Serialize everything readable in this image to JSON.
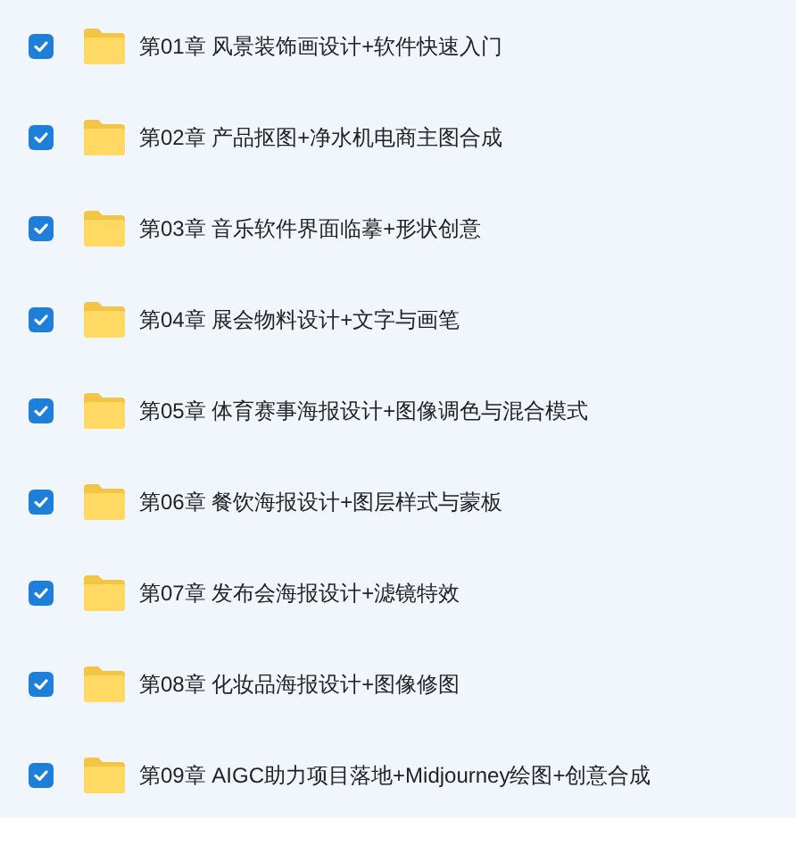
{
  "files": [
    {
      "name": "第01章 风景装饰画设计+软件快速入门",
      "checked": true
    },
    {
      "name": "第02章 产品抠图+净水机电商主图合成",
      "checked": true
    },
    {
      "name": "第03章 音乐软件界面临摹+形状创意",
      "checked": true
    },
    {
      "name": "第04章 展会物料设计+文字与画笔",
      "checked": true
    },
    {
      "name": "第05章 体育赛事海报设计+图像调色与混合模式",
      "checked": true
    },
    {
      "name": "第06章 餐饮海报设计+图层样式与蒙板",
      "checked": true
    },
    {
      "name": "第07章 发布会海报设计+滤镜特效",
      "checked": true
    },
    {
      "name": "第08章 化妆品海报设计+图像修图",
      "checked": true
    },
    {
      "name": "第09章 AIGC助力项目落地+Midjourney绘图+创意合成",
      "checked": true
    }
  ]
}
